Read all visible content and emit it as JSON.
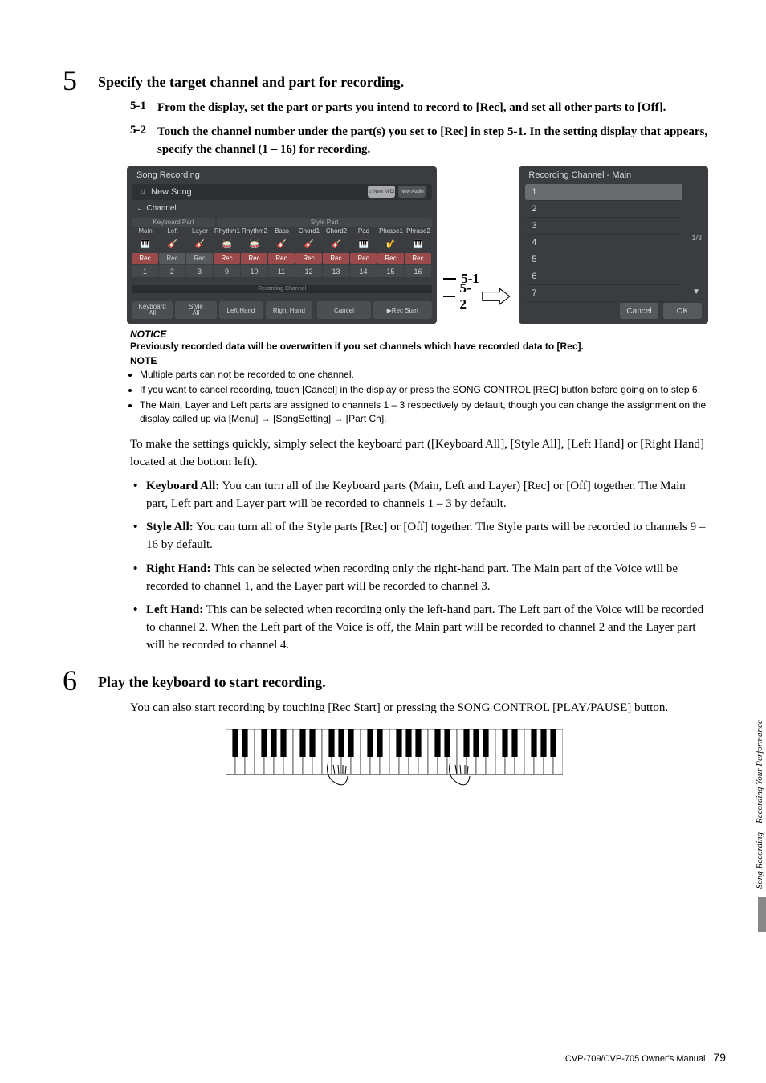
{
  "step5": {
    "num": "5",
    "title": "Specify the target channel and part for recording.",
    "sub1_num": "5-1",
    "sub1_txt": "From the display, set the part or parts you intend to record to [Rec], and set all other parts to [Off].",
    "sub2_num": "5-2",
    "sub2_txt": "Touch the channel number under the part(s) you set to [Rec] in step 5-1. In the setting display that appears, specify the channel (1 – 16) for recording."
  },
  "screen1": {
    "title": "Song Recording",
    "newsong": "New Song",
    "pill_midi": "New MIDI",
    "pill_audio": "New Audio",
    "channel": "Channel",
    "hdr_kbd": "Keyboard Part",
    "hdr_style": "Style Part",
    "cols": [
      "Main",
      "Left",
      "Layer",
      "Rhythm1",
      "Rhythm2",
      "Bass",
      "Chord1",
      "Chord2",
      "Pad",
      "Phrase1",
      "Phrase2"
    ],
    "nums": [
      "1",
      "2",
      "3",
      "9",
      "10",
      "11",
      "12",
      "13",
      "14",
      "15",
      "16"
    ],
    "rec": "Rec",
    "rc": "Recording Channel",
    "btn_kbdall_1": "Keyboard",
    "btn_kbdall_2": "All",
    "btn_styleall_1": "Style",
    "btn_styleall_2": "All",
    "btn_lh": "Left Hand",
    "btn_rh": "Right Hand",
    "btn_cancel": "Cancel",
    "btn_recstart": "▶Rec Start"
  },
  "callout": {
    "c1": "5-1",
    "c2": "5-2"
  },
  "screen2": {
    "title": "Recording Channel - Main",
    "rows": [
      "1",
      "2",
      "3",
      "4",
      "5",
      "6",
      "7"
    ],
    "page": "1/3",
    "cancel": "Cancel",
    "ok": "OK"
  },
  "notice": {
    "hdr": "NOTICE",
    "txt": "Previously recorded data will be overwritten if you set channels which have recorded data to [Rec]."
  },
  "note": {
    "hdr": "NOTE",
    "n1": "Multiple parts can not be recorded to one channel.",
    "n2": "If you want to cancel recording, touch [Cancel] in the display or press the SONG CONTROL [REC] button before going on to step 6.",
    "n3": "The Main, Layer and Left parts are assigned to channels 1 – 3 respectively by default, though you can change the assignment on the display called up via [Menu] → [SongSetting] → [Part Ch]."
  },
  "para1": "To make the settings quickly, simply select the keyboard part ([Keyboard All], [Style All], [Left Hand] or [Right Hand] located at the bottom left).",
  "defs": {
    "d1b": "Keyboard All:",
    "d1": " You can turn all of the Keyboard parts (Main, Left and Layer) [Rec] or [Off] together. The Main part, Left part and Layer part will be recorded to channels 1 – 3 by default.",
    "d2b": "Style All:",
    "d2": " You can turn all of the Style parts [Rec] or [Off] together. The Style parts will be recorded to channels 9 – 16 by default.",
    "d3b": "Right Hand:",
    "d3": " This can be selected when recording only the right-hand part. The Main part of the Voice will be recorded to channel 1, and the Layer part will be recorded to channel 3.",
    "d4b": "Left Hand:",
    "d4": " This can be selected when recording only the left-hand part. The Left part of the Voice will be recorded to channel 2. When the Left part of the Voice is off, the Main part will be recorded to channel 2 and the Layer part will be recorded to channel 4."
  },
  "step6": {
    "num": "6",
    "title": "Play the keyboard to start recording.",
    "body": "You can also start recording by touching [Rec Start] or pressing the SONG CONTROL [PLAY/PAUSE] button."
  },
  "side": "Song Recording – Recording Your Performance –",
  "footer": {
    "manual": "CVP-709/CVP-705 Owner's Manual",
    "page": "79"
  }
}
